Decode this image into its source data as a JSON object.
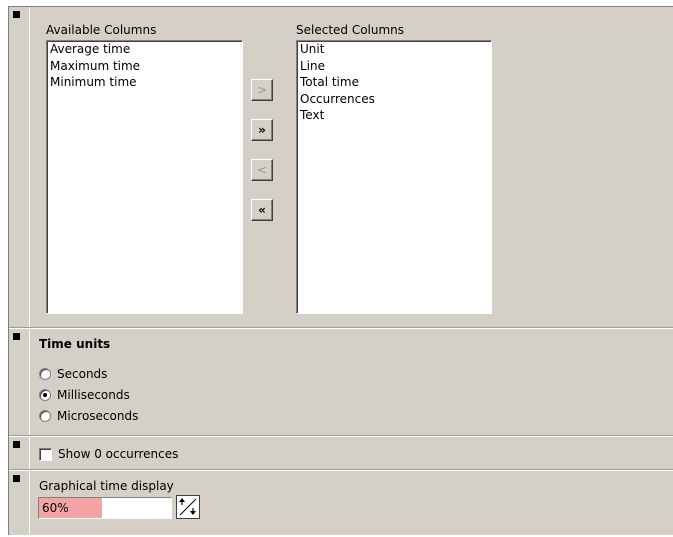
{
  "columns": {
    "available_label": "Available Columns",
    "available_items": [
      "Average time",
      "Maximum time",
      "Minimum time"
    ],
    "selected_label": "Selected Columns",
    "selected_items": [
      "Unit",
      "Line",
      "Total time",
      "Occurrences",
      "Text"
    ],
    "buttons": {
      "add": ">",
      "add_all": "»",
      "remove": "<",
      "remove_all": "«"
    }
  },
  "time_units": {
    "title": "Time units",
    "options": [
      "Seconds",
      "Milliseconds",
      "Microseconds"
    ],
    "selected": "Milliseconds"
  },
  "show_zero": {
    "label": "Show 0 occurrences",
    "checked": false
  },
  "graphical": {
    "label": "Graphical time display",
    "value_text": "60%",
    "fill_fraction": 0.48,
    "fill_color": "#f4a4a4"
  },
  "icons": {
    "section_marker": "square-marker-icon",
    "adjust": "increment-decrement-icon"
  }
}
